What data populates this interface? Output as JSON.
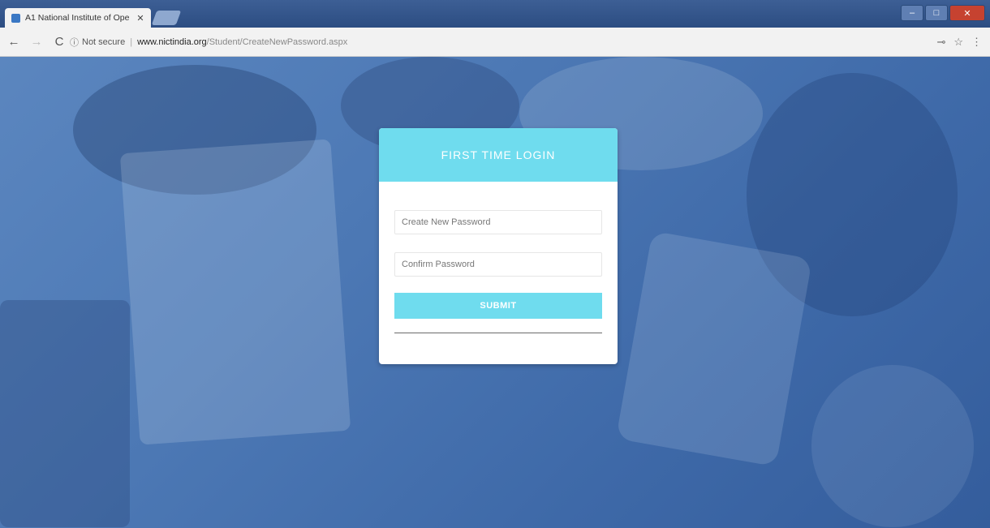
{
  "browser": {
    "tab_title": "A1 National Institute of Ope",
    "tab_close": "✕",
    "security_label": "Not secure",
    "url_host": "www.nictindia.org",
    "url_path": "/Student/CreateNewPassword.aspx",
    "back_icon": "←",
    "forward_icon": "→",
    "reload_icon": "C",
    "info_icon": "ⓘ",
    "key_icon": "⊸",
    "star_icon": "☆",
    "menu_icon": "⋮",
    "minimize_icon": "–",
    "maximize_icon": "□",
    "close_icon": "✕"
  },
  "login": {
    "heading": "FIRST TIME LOGIN",
    "new_password_placeholder": "Create New Password",
    "confirm_password_placeholder": "Confirm Password",
    "submit_label": "SUBMIT"
  },
  "colors": {
    "accent": "#6fdcee",
    "background": "#3f6aa8"
  }
}
